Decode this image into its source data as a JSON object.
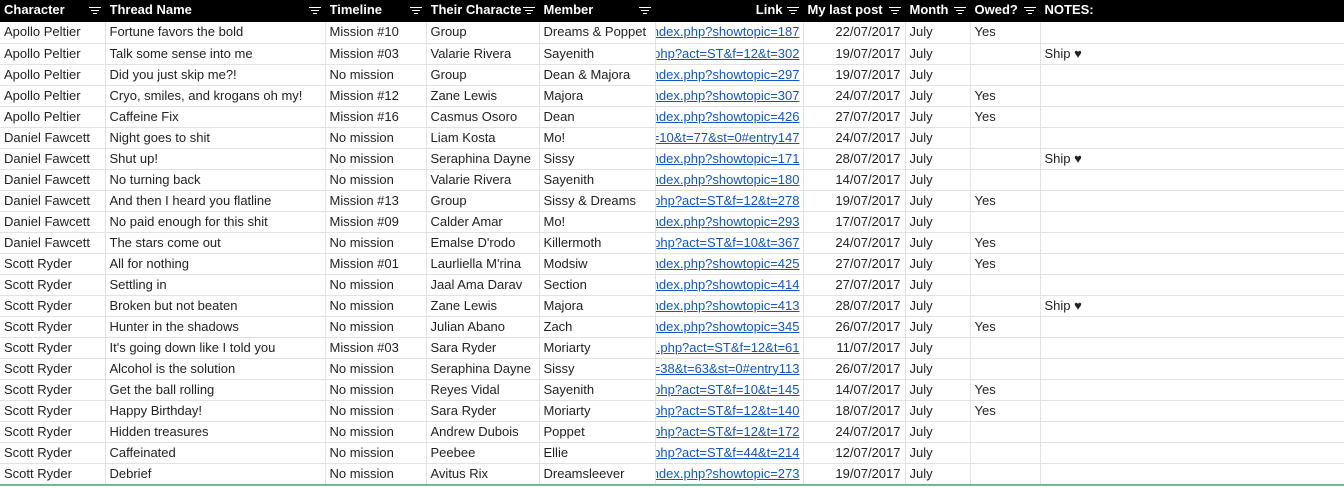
{
  "headers": [
    "Character",
    "Thread Name",
    "Timeline",
    "Their Characte",
    "Member",
    "Link",
    "My last post",
    "Month",
    "Owed?",
    "NOTES:"
  ],
  "rows": [
    [
      "Apollo Peltier",
      "Fortune favors the bold",
      "Mission #10",
      "Group",
      "Dreams & Poppet",
      "ndex.php?showtopic=187",
      "22/07/2017",
      "July",
      "Yes",
      ""
    ],
    [
      "Apollo Peltier",
      "Talk some sense into me",
      "Mission #03",
      "Valarie Rivera",
      "Sayenith",
      "php?act=ST&f=12&t=302",
      "19/07/2017",
      "July",
      "",
      "Ship ♥"
    ],
    [
      "Apollo Peltier",
      "Did you just skip me?!",
      "No mission",
      "Group",
      "Dean & Majora",
      "ndex.php?showtopic=297",
      "19/07/2017",
      "July",
      "",
      ""
    ],
    [
      "Apollo Peltier",
      "Cryo, smiles, and krogans oh my!",
      "Mission #12",
      "Zane Lewis",
      "Majora",
      "ndex.php?showtopic=307",
      "24/07/2017",
      "July",
      "Yes",
      ""
    ],
    [
      "Apollo Peltier",
      "Caffeine Fix",
      "Mission #16",
      "Casmus Osoro",
      "Dean",
      "ndex.php?showtopic=426",
      "27/07/2017",
      "July",
      "Yes",
      ""
    ],
    [
      "Daniel Fawcett",
      "Night goes to shit",
      "No mission",
      "Liam Kosta",
      "Mo!",
      "=10&t=77&st=0#entry147",
      "24/07/2017",
      "July",
      "",
      ""
    ],
    [
      "Daniel Fawcett",
      "Shut up!",
      "No mission",
      "Seraphina Dayne",
      "Sissy",
      "ndex.php?showtopic=171",
      "28/07/2017",
      "July",
      "",
      "Ship ♥"
    ],
    [
      "Daniel Fawcett",
      "No turning back",
      "No mission",
      "Valarie Rivera",
      "Sayenith",
      "ndex.php?showtopic=180",
      "14/07/2017",
      "July",
      "",
      ""
    ],
    [
      "Daniel Fawcett",
      "And then I heard you flatline",
      "Mission #13",
      "Group",
      "Sissy & Dreams",
      "php?act=ST&f=12&t=278",
      "19/07/2017",
      "July",
      "Yes",
      ""
    ],
    [
      "Daniel Fawcett",
      "No paid enough for this shit",
      "Mission #09",
      "Calder Amar",
      "Mo!",
      "ndex.php?showtopic=293",
      "17/07/2017",
      "July",
      "",
      ""
    ],
    [
      "Daniel Fawcett",
      "The stars come out",
      "No mission",
      "Emalse D'rodo",
      "Killermoth",
      "php?act=ST&f=10&t=367",
      "24/07/2017",
      "July",
      "Yes",
      ""
    ],
    [
      "Scott Ryder",
      "All for nothing",
      "Mission #01",
      "Laurliella M'rina",
      "Modsiw",
      "ndex.php?showtopic=425",
      "27/07/2017",
      "July",
      "Yes",
      ""
    ],
    [
      "Scott Ryder",
      "Settling in",
      "No mission",
      "Jaal Ama Darav",
      "Section",
      "ndex.php?showtopic=414",
      "27/07/2017",
      "July",
      "",
      ""
    ],
    [
      "Scott Ryder",
      "Broken but not beaten",
      "No mission",
      "Zane Lewis",
      "Majora",
      "ndex.php?showtopic=413",
      "28/07/2017",
      "July",
      "",
      "Ship ♥"
    ],
    [
      "Scott Ryder",
      "Hunter in the shadows",
      "No mission",
      "Julian Abano",
      "Zach",
      "ndex.php?showtopic=345",
      "26/07/2017",
      "July",
      "Yes",
      ""
    ],
    [
      "Scott Ryder",
      "It's going down like I told you",
      "Mission #03",
      "Sara Ryder",
      "Moriarty",
      "x.php?act=ST&f=12&t=61",
      "11/07/2017",
      "July",
      "",
      ""
    ],
    [
      "Scott Ryder",
      "Alcohol is the solution",
      "No mission",
      "Seraphina Dayne",
      "Sissy",
      "=38&t=63&st=0#entry113",
      "26/07/2017",
      "July",
      "",
      ""
    ],
    [
      "Scott Ryder",
      "Get the ball rolling",
      "No mission",
      "Reyes Vidal",
      "Sayenith",
      "php?act=ST&f=10&t=145",
      "14/07/2017",
      "July",
      "Yes",
      ""
    ],
    [
      "Scott Ryder",
      "Happy Birthday!",
      "No mission",
      "Sara Ryder",
      "Moriarty",
      "php?act=ST&f=12&t=140",
      "18/07/2017",
      "July",
      "Yes",
      ""
    ],
    [
      "Scott Ryder",
      "Hidden treasures",
      "No mission",
      "Andrew Dubois",
      "Poppet",
      "php?act=ST&f=12&t=172",
      "24/07/2017",
      "July",
      "",
      ""
    ],
    [
      "Scott Ryder",
      "Caffeinated",
      "No mission",
      "Peebee",
      "Ellie",
      "php?act=ST&f=44&t=214",
      "12/07/2017",
      "July",
      "",
      ""
    ],
    [
      "Scott Ryder",
      "Debrief",
      "No mission",
      "Avitus Rix",
      "Dreamsleever",
      "ndex.php?showtopic=273",
      "19/07/2017",
      "July",
      "",
      ""
    ]
  ]
}
